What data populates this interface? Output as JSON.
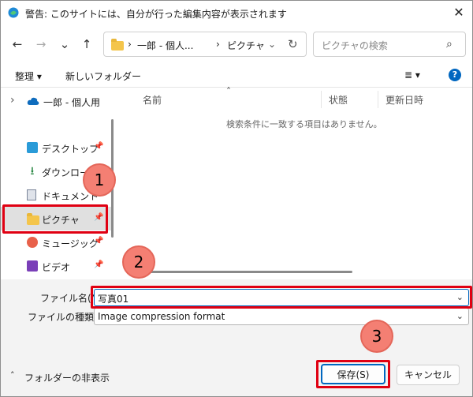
{
  "titlebar": {
    "title": "警告: このサイトには、自分が行った編集内容が表示されます",
    "close": "✕"
  },
  "nav": {
    "back": "←",
    "forward": "→",
    "dropdown": "⌄",
    "up": "↑",
    "address": {
      "sep1": "›",
      "seg1": "一郎 - 個人...",
      "sep2": "›",
      "seg2": "ピクチャ",
      "chevron": "⌄",
      "refresh": "↻"
    },
    "search": {
      "placeholder": "ピクチャの検索",
      "icon": "⌕"
    }
  },
  "toolbar": {
    "organize": "整理 ▾",
    "new_folder": "新しいフォルダー",
    "view": "≣  ▾",
    "help": "?"
  },
  "sidebar": {
    "onedrive": {
      "arrow": "›",
      "label": "一郎 - 個人用"
    },
    "items": [
      {
        "label": "デスクトップ",
        "pin": "📌"
      },
      {
        "label": "ダウンロード",
        "pin": "📌"
      },
      {
        "label": "ドキュメント",
        "pin": "📌"
      },
      {
        "label": "ピクチャ",
        "pin": "📌"
      },
      {
        "label": "ミュージック",
        "pin": "📌"
      },
      {
        "label": "ビデオ",
        "pin": "📌"
      }
    ]
  },
  "list": {
    "columns": [
      "名前",
      "状態",
      "更新日時"
    ],
    "sort_caret": "˄",
    "empty_message": "検索条件に一致する項目はありません。"
  },
  "form": {
    "filename_label": "ファイル名(N):",
    "filename_value": "写真01",
    "filetype_label": "ファイルの種類(T):",
    "filetype_value": "Image compression format",
    "arrow": "⌄"
  },
  "footer": {
    "hide_folders": "フォルダーの非表示",
    "hide_arrow": "˄",
    "save": "保存(S)",
    "cancel": "キャンセル"
  },
  "annotations": {
    "step1": "1",
    "step2": "2",
    "step3": "3"
  }
}
